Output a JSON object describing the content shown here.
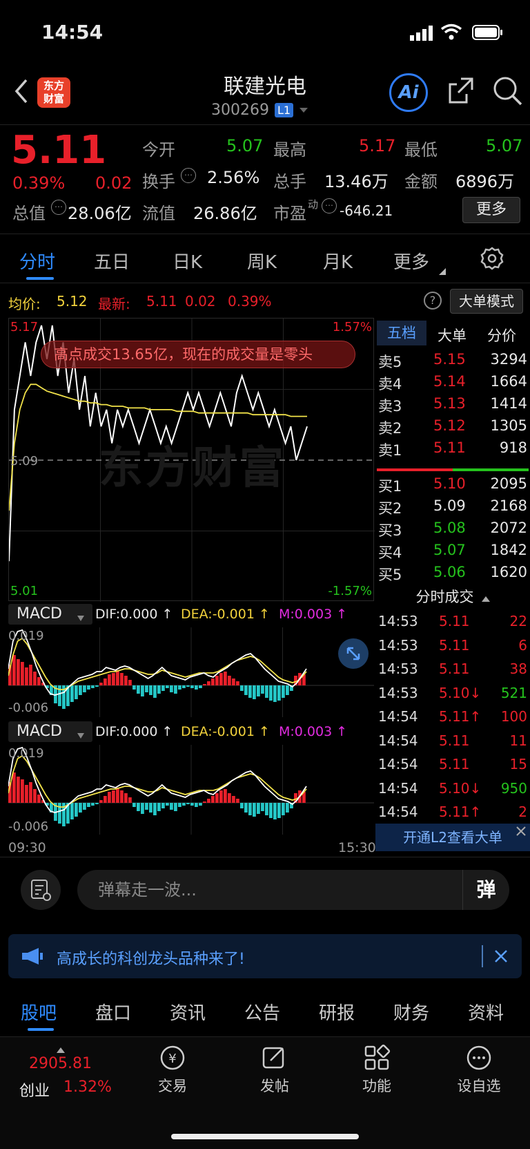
{
  "status": {
    "time": "14:54"
  },
  "header": {
    "title": "联建光电",
    "code": "300269",
    "level_badge": "L1",
    "logo_text_1": "东方",
    "logo_text_2": "财富",
    "ai_label": "Ai"
  },
  "quote": {
    "price": "5.11",
    "change_pct": "0.39%",
    "change": "0.02",
    "open_label": "今开",
    "open": "5.07",
    "high_label": "最高",
    "high": "5.17",
    "low_label": "最低",
    "low": "5.07",
    "turnover_label": "换手",
    "turnover": "2.56%",
    "volume_label": "总手",
    "volume": "13.46万",
    "amount_label": "金额",
    "amount": "6896万",
    "mcap_label": "总值",
    "mcap": "28.06亿",
    "float_label": "流值",
    "float": "26.86亿",
    "pe_label": "市盈",
    "pe_sup": "动",
    "pe": "-646.21",
    "more_btn": "更多"
  },
  "tabs": [
    {
      "label": "分时"
    },
    {
      "label": "五日"
    },
    {
      "label": "日K"
    },
    {
      "label": "周K"
    },
    {
      "label": "月K"
    },
    {
      "label": "更多"
    }
  ],
  "chart_info": {
    "avg_label": "均价:",
    "avg": "5.12",
    "latest_label": "最新:",
    "latest": "5.11",
    "chg": "0.02",
    "pct": "0.39%",
    "mode_btn": "大单模式",
    "y_top": "5.17",
    "y_mid": "5.09",
    "y_bot": "5.01",
    "pct_top": "1.57%",
    "pct_bot": "-1.57%",
    "callout": "高点成交13.65亿，现在的成交量是零头",
    "watermark": "东方财富",
    "x_start": "09:30",
    "x_end": "15:30"
  },
  "macd": {
    "label": "MACD",
    "dif": "DIF:0.000 ↑",
    "dea": "DEA:-0.001 ↑",
    "m": "M:0.003 ↑",
    "y_top": "0.019",
    "y_bot": "-0.006"
  },
  "chart_data": {
    "type": "line",
    "title": "",
    "series": [
      {
        "name": "",
        "values": [
          5.03,
          5.12,
          5.14,
          5.16,
          5.14,
          5.16,
          5.17,
          5.15,
          5.17,
          5.14,
          5.16,
          5.13,
          5.15,
          5.12,
          5.14,
          5.11,
          5.13,
          5.11,
          5.12,
          5.1,
          5.12,
          5.11,
          5.12,
          5.11,
          5.1,
          5.11,
          5.12,
          5.11,
          5.1,
          5.11,
          5.1,
          5.11,
          5.12,
          5.13,
          5.12,
          5.13,
          5.12,
          5.11,
          5.12,
          5.13,
          5.12,
          5.11,
          5.13,
          5.14,
          5.13,
          5.12,
          5.13,
          5.12,
          5.11,
          5.12,
          5.11,
          5.1,
          5.11,
          5.09,
          5.1,
          5.11
        ]
      },
      {
        "name": "均价",
        "values": [
          5.06,
          5.1,
          5.12,
          5.13,
          5.135,
          5.135,
          5.133,
          5.131,
          5.13,
          5.129,
          5.128,
          5.127,
          5.126,
          5.125,
          5.125,
          5.124,
          5.124,
          5.123,
          5.123,
          5.122,
          5.122,
          5.122,
          5.121,
          5.121,
          5.121,
          5.121,
          5.12,
          5.12,
          5.12,
          5.12,
          5.12,
          5.119,
          5.119,
          5.119,
          5.119,
          5.118,
          5.118,
          5.118,
          5.118,
          5.118,
          5.118,
          5.118,
          5.118,
          5.118,
          5.118,
          5.117,
          5.117,
          5.117,
          5.117,
          5.117,
          5.117,
          5.117,
          5.116,
          5.116,
          5.116,
          5.116
        ]
      }
    ],
    "ylim": [
      5.01,
      5.17
    ]
  },
  "order_book": {
    "tabs": [
      "五档",
      "大单",
      "分价"
    ],
    "asks": [
      {
        "label": "卖5",
        "price": "5.15",
        "vol": "3294"
      },
      {
        "label": "卖4",
        "price": "5.14",
        "vol": "1664"
      },
      {
        "label": "卖3",
        "price": "5.13",
        "vol": "1414"
      },
      {
        "label": "卖2",
        "price": "5.12",
        "vol": "1305"
      },
      {
        "label": "卖1",
        "price": "5.11",
        "vol": "918"
      }
    ],
    "bids": [
      {
        "label": "买1",
        "price": "5.10",
        "vol": "2095"
      },
      {
        "label": "买2",
        "price": "5.09",
        "vol": "2168"
      },
      {
        "label": "买3",
        "price": "5.08",
        "vol": "2072"
      },
      {
        "label": "买4",
        "price": "5.07",
        "vol": "1842"
      },
      {
        "label": "买5",
        "price": "5.06",
        "vol": "1620"
      }
    ],
    "trades_title": "分时成交",
    "trades": [
      {
        "t": "14:53",
        "p": "5.11",
        "v": "22"
      },
      {
        "t": "14:53",
        "p": "5.11",
        "v": "6"
      },
      {
        "t": "14:53",
        "p": "5.11",
        "v": "38"
      },
      {
        "t": "14:53",
        "p": "5.10↓",
        "v": "521"
      },
      {
        "t": "14:54",
        "p": "5.11↑",
        "v": "100"
      },
      {
        "t": "14:54",
        "p": "5.11",
        "v": "11"
      },
      {
        "t": "14:54",
        "p": "5.11",
        "v": "15"
      },
      {
        "t": "14:54",
        "p": "5.10↓",
        "v": "950"
      },
      {
        "t": "14:54",
        "p": "5.11↑",
        "v": "2"
      }
    ],
    "l2_banner": "开通L2查看大单"
  },
  "comment": {
    "placeholder": "弹幕走一波...",
    "danmu": "弹"
  },
  "notice": {
    "text": "高成长的科创龙头品种来了!"
  },
  "bottom_tabs": [
    "股吧",
    "盘口",
    "资讯",
    "公告",
    "研报",
    "财务",
    "资料"
  ],
  "toolbar": {
    "index_value": "2905.81",
    "index_name": "创业",
    "index_pct": "1.32%",
    "trade": "交易",
    "post": "发帖",
    "func": "功能",
    "watch": "设自选"
  }
}
